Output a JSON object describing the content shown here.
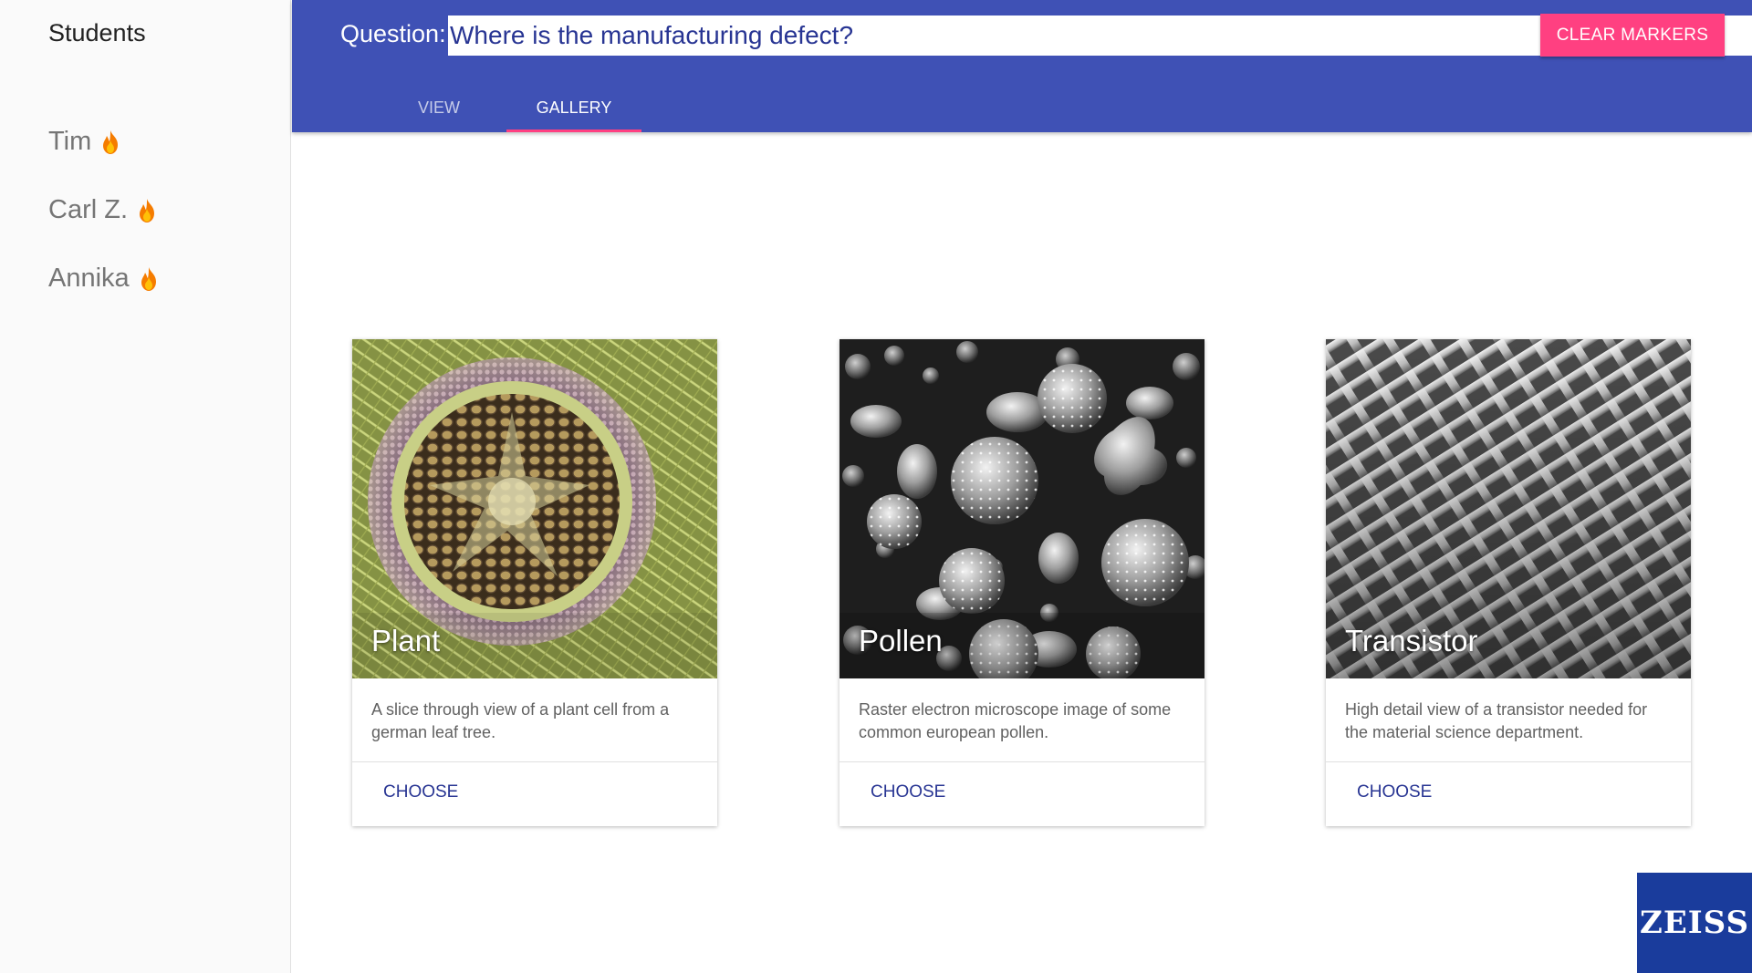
{
  "sidebar": {
    "title": "Students",
    "students": [
      {
        "name": "Tim",
        "icon": "flame-icon"
      },
      {
        "name": "Carl Z.",
        "icon": "flame-icon"
      },
      {
        "name": "Annika",
        "icon": "flame-icon"
      }
    ]
  },
  "header": {
    "question_label": "Question:",
    "question_value": "Where is the manufacturing defect?",
    "clear_button": "CLEAR MARKERS",
    "tabs": [
      {
        "label": "VIEW",
        "active": false
      },
      {
        "label": "GALLERY",
        "active": true
      }
    ]
  },
  "gallery": {
    "cards": [
      {
        "title": "Plant",
        "description": "A slice through view of a plant cell from a german leaf tree.",
        "action": "CHOOSE"
      },
      {
        "title": "Pollen",
        "description": "Raster electron microscope image of some common european pollen.",
        "action": "CHOOSE"
      },
      {
        "title": "Transistor",
        "description": "High detail view of a transistor needed for the material science department.",
        "action": "CHOOSE"
      }
    ]
  },
  "logo": {
    "text": "ZEISS"
  },
  "colors": {
    "primary": "#3f51b5",
    "accent": "#ff4081",
    "action_text": "#283593",
    "logo_bg": "#1a3c9c"
  }
}
